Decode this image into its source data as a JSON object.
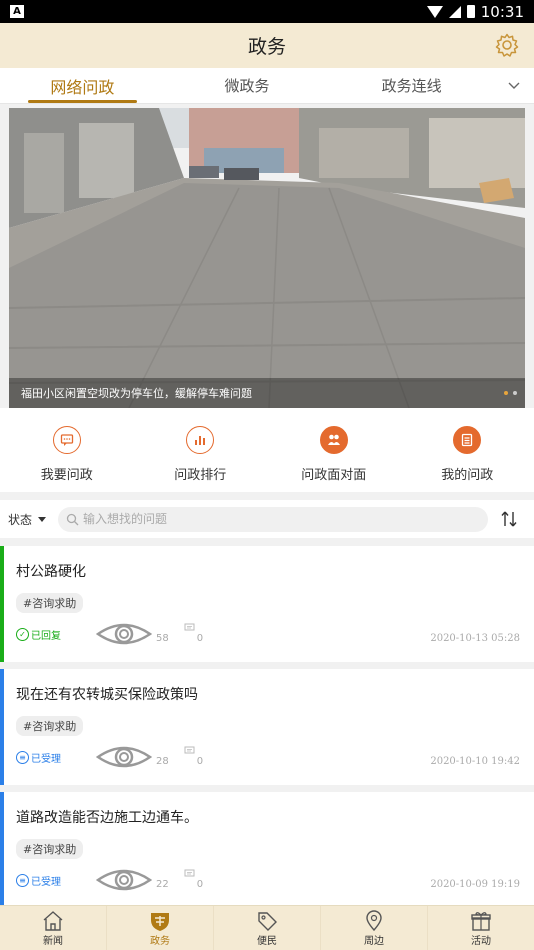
{
  "status_bar": {
    "time": "10:31"
  },
  "header": {
    "title": "政务"
  },
  "tabs": [
    {
      "label": "网络问政",
      "active": true
    },
    {
      "label": "微政务",
      "active": false
    },
    {
      "label": "政务连线",
      "active": false
    }
  ],
  "banner": {
    "caption": "福田小区闲置空坝改为停车位，缓解停车难问题",
    "dots": 2,
    "active_dot": 0
  },
  "quick_actions": [
    {
      "label": "我要问政",
      "icon": "chat-bubble-icon"
    },
    {
      "label": "问政排行",
      "icon": "bar-chart-icon"
    },
    {
      "label": "问政面对面",
      "icon": "people-icon"
    },
    {
      "label": "我的问政",
      "icon": "list-icon"
    }
  ],
  "filter": {
    "status_label": "状态",
    "search_placeholder": "输入想找的问题"
  },
  "items": [
    {
      "title": "村公路硬化",
      "tag": "#咨询求助",
      "status": "已回复",
      "status_color": "#1aad19",
      "views": "58",
      "comments": "0",
      "date": "2020-10-13 05:28"
    },
    {
      "title": "现在还有农转城买保险政策吗",
      "tag": "#咨询求助",
      "status": "已受理",
      "status_color": "#2b7fe8",
      "views": "28",
      "comments": "0",
      "date": "2020-10-10 19:42"
    },
    {
      "title": "道路改造能否边施工边通车。",
      "tag": "#咨询求助",
      "status": "已受理",
      "status_color": "#2b7fe8",
      "views": "22",
      "comments": "0",
      "date": "2020-10-09 19:19"
    }
  ],
  "bottom_nav": [
    {
      "label": "新闻",
      "icon": "home-icon",
      "active": false
    },
    {
      "label": "政务",
      "icon": "shield-icon",
      "active": true
    },
    {
      "label": "便民",
      "icon": "tag-icon",
      "active": false
    },
    {
      "label": "周边",
      "icon": "location-icon",
      "active": false
    },
    {
      "label": "活动",
      "icon": "gift-icon",
      "active": false
    }
  ],
  "colors": {
    "accent": "#b07a14",
    "header_bg": "#f4ead3",
    "quick_icon": "#e46a2e"
  }
}
